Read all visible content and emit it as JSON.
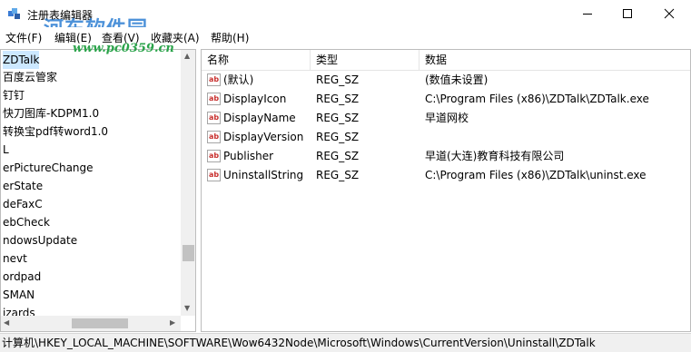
{
  "window": {
    "title": "注册表编辑器",
    "minimize_icon": "minimize-icon",
    "maximize_icon": "maximize-icon",
    "close_icon": "close-icon"
  },
  "watermark": {
    "text": "河东软件园",
    "url": "www.pc0359.cn"
  },
  "menu": {
    "items": [
      "文件(F)",
      "编辑(E)",
      "查看(V)",
      "收藏夹(A)",
      "帮助(H)"
    ]
  },
  "tree": {
    "items": [
      {
        "label": "ZDTalk",
        "selected": true
      },
      {
        "label": "百度云管家"
      },
      {
        "label": "钉钉"
      },
      {
        "label": "快刀图库-KDPM1.0"
      },
      {
        "label": "转换宝pdf转word1.0"
      },
      {
        "label": "L"
      },
      {
        "label": "erPictureChange"
      },
      {
        "label": "erState"
      },
      {
        "label": "deFaxC"
      },
      {
        "label": "ebCheck"
      },
      {
        "label": "ndowsUpdate"
      },
      {
        "label": "nevt"
      },
      {
        "label": "ordpad"
      },
      {
        "label": "SMAN"
      },
      {
        "label": "izards"
      }
    ]
  },
  "list": {
    "columns": [
      "名称",
      "类型",
      "数据"
    ],
    "rows": [
      {
        "name": "(默认)",
        "type": "REG_SZ",
        "data": "(数值未设置)"
      },
      {
        "name": "DisplayIcon",
        "type": "REG_SZ",
        "data": "C:\\Program Files (x86)\\ZDTalk\\ZDTalk.exe"
      },
      {
        "name": "DisplayName",
        "type": "REG_SZ",
        "data": "早道网校"
      },
      {
        "name": "DisplayVersion",
        "type": "REG_SZ",
        "data": ""
      },
      {
        "name": "Publisher",
        "type": "REG_SZ",
        "data": "早道(大连)教育科技有限公司"
      },
      {
        "name": "UninstallString",
        "type": "REG_SZ",
        "data": "C:\\Program Files (x86)\\ZDTalk\\uninst.exe"
      }
    ],
    "value_icon": "string-value-icon"
  },
  "status": {
    "path": "计算机\\HKEY_LOCAL_MACHINE\\SOFTWARE\\Wow6432Node\\Microsoft\\Windows\\CurrentVersion\\Uninstall\\ZDTalk"
  },
  "colors": {
    "selection": "#cce8ff",
    "watermark": "#2f7fd3",
    "watermark_url": "#2aa34a"
  }
}
